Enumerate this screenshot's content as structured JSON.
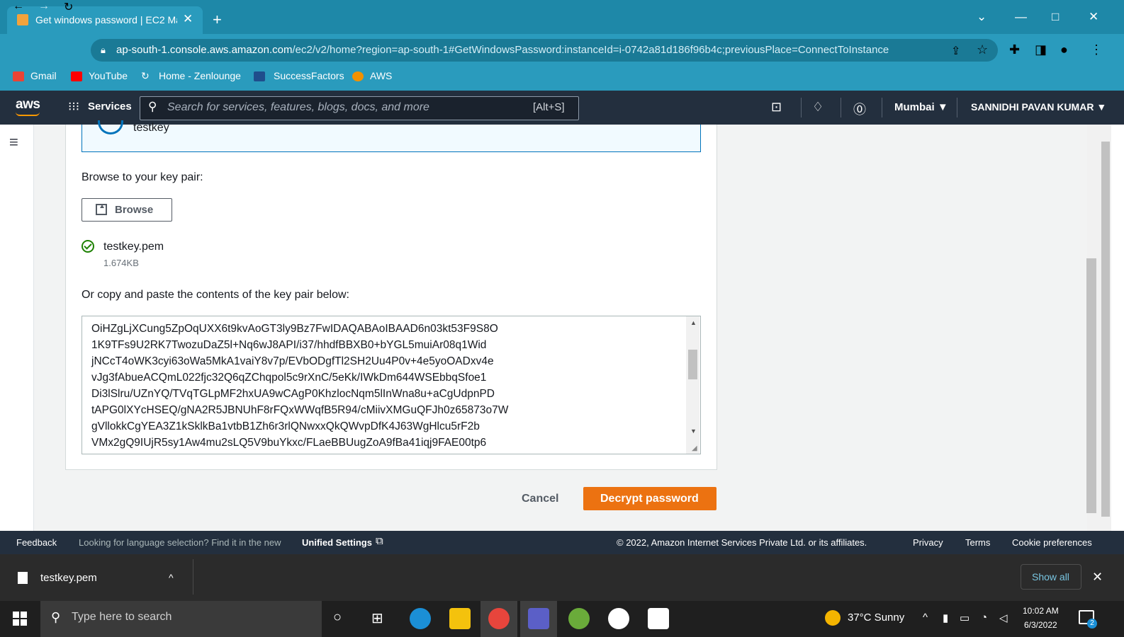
{
  "browser": {
    "tab_title": "Get windows password | EC2 Ma",
    "url_domain": "ap-south-1.console.aws.amazon.com",
    "url_path": "/ec2/v2/home?region=ap-south-1#GetWindowsPassword:instanceId=i-0742a81d186f96b4c;previousPlace=ConnectToInstance",
    "bookmarks": [
      "Gmail",
      "YouTube",
      "Home - Zenlounge",
      "SuccessFactors",
      "AWS"
    ]
  },
  "aws_header": {
    "logo": "aws",
    "services_label": "Services",
    "search_placeholder": "Search for services, features, blogs, docs, and more",
    "search_shortcut": "[Alt+S]",
    "region": "Mumbai ▼",
    "user": "SANNIDHI PAVAN KUMAR ▼"
  },
  "form": {
    "key_name": "testkey",
    "browse_prompt": "Browse to your key pair:",
    "browse_button": "Browse",
    "file_name": "testkey.pem",
    "file_size": "1.674KB",
    "paste_prompt": "Or copy and paste the contents of the key pair below:",
    "key_lines": [
      "OiHZgLjXCung5ZpOqUXX6t9kvAoGT3ly9Bz7FwIDAQABAoIBAAD6n03kt53F9S8O",
      "1K9TFs9U2RK7TwozuDaZ5l+Nq6wJ8API/i37/hhdfBBXB0+bYGL5muiAr08q1Wid",
      "jNCcT4oWK3cyi63oWa5MkA1vaiY8v7p/EVbODgfTl2SH2Uu4P0v+4e5yoOADxv4e",
      "vJg3fAbueACQmL022fjc32Q6qZChqpol5c9rXnC/5eKk/IWkDm644WSEbbqSfoe1",
      "Di3lSlru/UZnYQ/TVqTGLpMF2hxUA9wCAgP0KhzlocNqm5lInWna8u+aCgUdpnPD",
      "tAPG0lXYcHSEQ/gNA2R5JBNUhF8rFQxWWqfB5R94/cMiivXMGuQFJh0z65873o7W",
      "gVllokkCgYEA3Z1kSklkBa1vtbB1Zh6r3rlQNwxxQkQWvpDfK4J63WgHlcu5rF2b",
      "VMx2gQ9IUjR5sy1Aw4mu2sLQ5V9buYkxc/FLaeBBUugZoA9fBa41iqj9FAE00tp6"
    ],
    "cancel": "Cancel",
    "decrypt": "Decrypt password"
  },
  "footer": {
    "feedback": "Feedback",
    "lang_prompt": "Looking for language selection? Find it in the new",
    "unified_settings": "Unified Settings",
    "copyright": "© 2022, Amazon Internet Services Private Ltd. or its affiliates.",
    "privacy": "Privacy",
    "terms": "Terms",
    "cookie": "Cookie preferences"
  },
  "download_bar": {
    "file": "testkey.pem",
    "show_all": "Show all"
  },
  "taskbar": {
    "search_placeholder": "Type here to search",
    "weather": "37°C  Sunny",
    "time": "10:02 AM",
    "date": "6/3/2022",
    "notification_count": "2"
  },
  "colors": {
    "accent": "#ec7211",
    "aws_dark": "#232f3e",
    "link": "#0073bb",
    "success": "#1d8102"
  }
}
